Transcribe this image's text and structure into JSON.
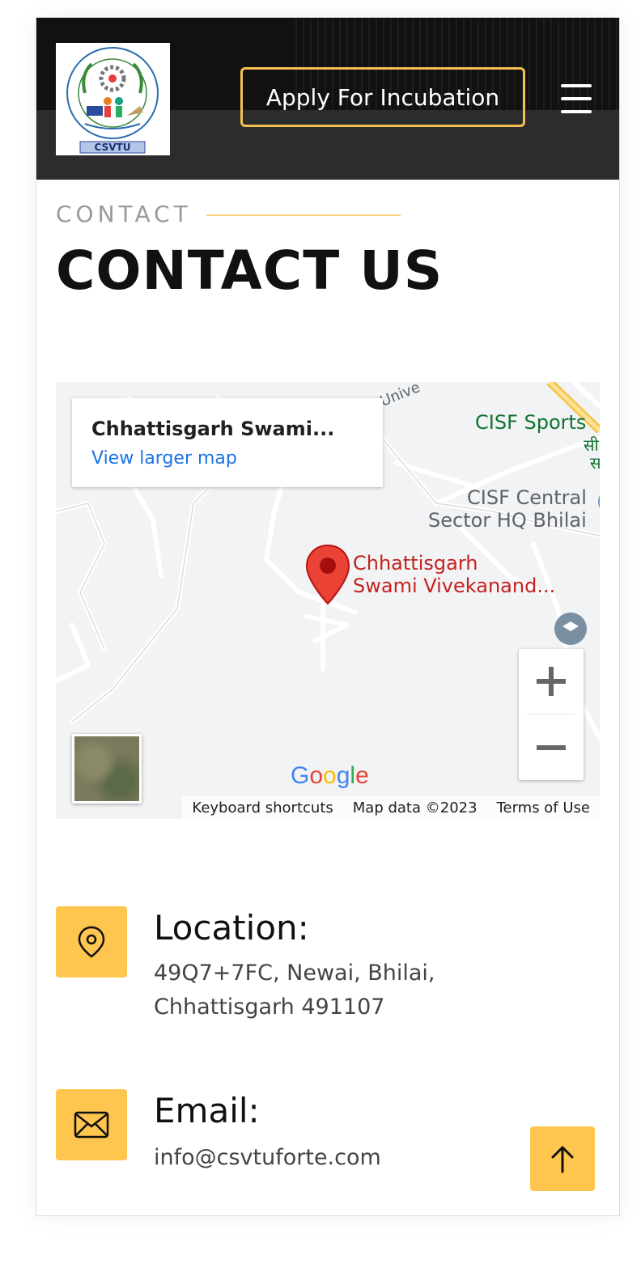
{
  "header": {
    "logo_text": "CSVTU",
    "apply_button_label": "Apply For Incubation",
    "menu_icon": "hamburger-menu-icon",
    "accent_color": "#f5c052"
  },
  "section": {
    "eyebrow": "CONTACT",
    "title": "CONTACT US"
  },
  "map": {
    "place_name": "Chhattisgarh Swami...",
    "larger_map_link": "View larger map",
    "labels": {
      "cisf_sports": "CISF Sports",
      "cisf_central_line1": "CISF Central",
      "cisf_central_line2": "Sector HQ Bhilai",
      "pin_line1": "Chhattisgarh",
      "pin_line2": "Swami Vivekanand...",
      "hindi_line1": "सी",
      "hindi_line2": "स",
      "univ": "Unive"
    },
    "zoom_in_label": "+",
    "zoom_out_label": "−",
    "google_logo": "Google",
    "footer": {
      "keyboard": "Keyboard shortcuts",
      "map_data": "Map data ©2023",
      "terms": "Terms of Use"
    }
  },
  "contact": {
    "location_title": "Location:",
    "location_text": "49Q7+7FC, Newai, Bhilai, Chhattisgarh 491107",
    "email_title": "Email:",
    "email_text": "info@csvtuforte.com",
    "icon_color": "#fec54f"
  }
}
